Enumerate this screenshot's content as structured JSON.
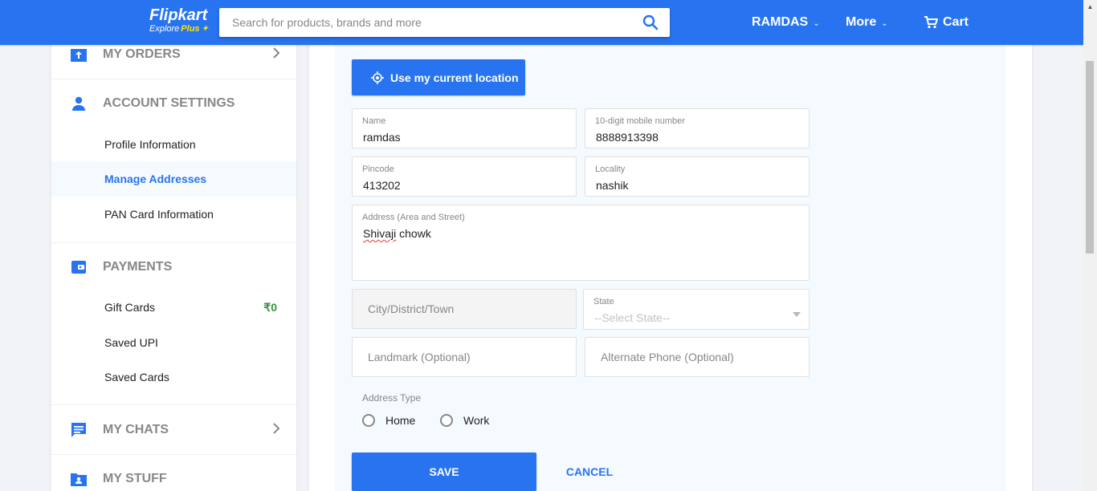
{
  "header": {
    "logo": "Flipkart",
    "logo_sub_a": "Explore",
    "logo_sub_b": "Plus",
    "search_placeholder": "Search for products, brands and more",
    "user": "RAMDAS",
    "more": "More",
    "cart": "Cart",
    "accent": "#2874f0"
  },
  "sidebar": {
    "my_orders": "MY ORDERS",
    "account_settings": "ACCOUNT SETTINGS",
    "account_items": [
      "Profile Information",
      "Manage Addresses",
      "PAN Card Information"
    ],
    "payments": "PAYMENTS",
    "payment_items": [
      "Gift Cards",
      "Saved UPI",
      "Saved Cards"
    ],
    "gift_card_balance": "₹0",
    "my_chats": "MY CHATS",
    "my_stuff": "MY STUFF"
  },
  "form": {
    "use_location": "Use my current location",
    "name": {
      "label": "Name",
      "value": "ramdas"
    },
    "mobile": {
      "label": "10-digit mobile number",
      "value": "8888913398"
    },
    "pincode": {
      "label": "Pincode",
      "value": "413202"
    },
    "locality": {
      "label": "Locality",
      "value": "nashik"
    },
    "address": {
      "label": "Address (Area and Street)",
      "value_word1": "Shivaji",
      "value_word2": " chowk"
    },
    "city": {
      "placeholder": "City/District/Town"
    },
    "state": {
      "label": "State",
      "placeholder": "--Select State--"
    },
    "landmark": {
      "placeholder": "Landmark (Optional)"
    },
    "alt_phone": {
      "placeholder": "Alternate Phone (Optional)"
    },
    "address_type_label": "Address Type",
    "address_types": [
      "Home",
      "Work"
    ],
    "save": "SAVE",
    "cancel": "CANCEL"
  }
}
